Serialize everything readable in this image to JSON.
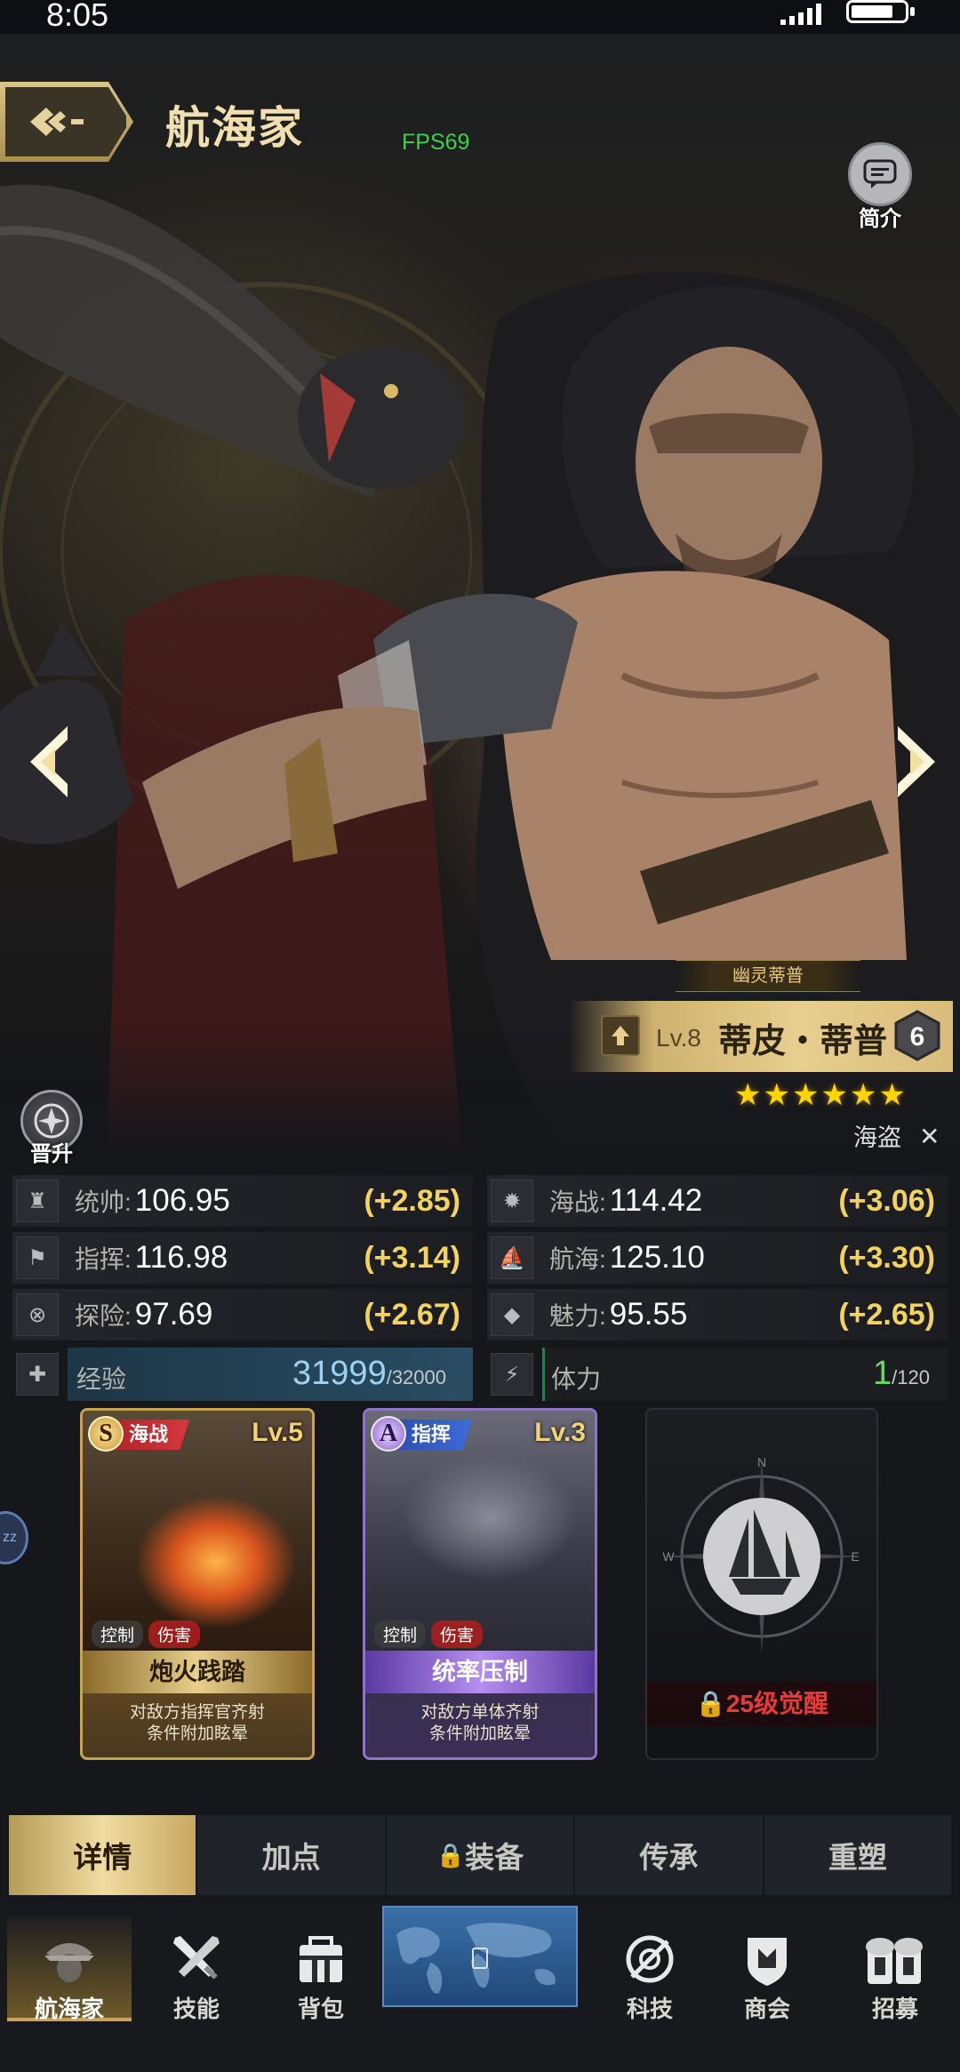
{
  "status_bar": {
    "time": "8:05"
  },
  "header": {
    "title": "航海家",
    "fps": "FPS69",
    "intro_label": "简介"
  },
  "hero": {
    "title_tag": "幽灵蒂普",
    "level": "Lv.8",
    "name": "蒂皮・蒂普",
    "rank": "6",
    "stars": "★★★★★★",
    "star_count": 6,
    "faction": "海盗",
    "promote_label": "晋升"
  },
  "stats": [
    {
      "icon": "general-icon",
      "label": "统帅:",
      "value": "106.95",
      "bonus": "(+2.85)"
    },
    {
      "icon": "naval-battle-icon",
      "label": "海战:",
      "value": "114.42",
      "bonus": "(+3.06)"
    },
    {
      "icon": "command-flag-icon",
      "label": "指挥:",
      "value": "116.98",
      "bonus": "(+3.14)"
    },
    {
      "icon": "sailing-icon",
      "label": "航海:",
      "value": "125.10",
      "bonus": "(+3.30)"
    },
    {
      "icon": "compass-icon",
      "label": "探险:",
      "value": "97.69",
      "bonus": "(+2.67)"
    },
    {
      "icon": "diamond-icon",
      "label": "魅力:",
      "value": "95.55",
      "bonus": "(+2.65)"
    }
  ],
  "experience": {
    "label": "经验",
    "current": "31999",
    "max": "/32000"
  },
  "stamina": {
    "label": "体力",
    "current": "1",
    "max": "/120"
  },
  "skills": [
    {
      "grade": "S",
      "type": "海战",
      "level": "Lv.5",
      "tags": [
        "控制",
        "伤害"
      ],
      "name": "炮火践踏",
      "desc": "对敌方指挥官齐射\n条件附加眩晕"
    },
    {
      "grade": "A",
      "type": "指挥",
      "level": "Lv.3",
      "tags": [
        "控制",
        "伤害"
      ],
      "name": "统率压制",
      "desc": "对敌方单体齐射\n条件附加眩晕"
    }
  ],
  "locked_slot": {
    "text": "25级觉醒",
    "compass_letters": [
      "N",
      "W",
      "E"
    ]
  },
  "side_bubble": "zz",
  "tabs": [
    {
      "label": "详情",
      "active": true
    },
    {
      "label": "加点",
      "active": false
    },
    {
      "label": "装备",
      "active": false,
      "locked": true
    },
    {
      "label": "传承",
      "active": false
    },
    {
      "label": "重塑",
      "active": false
    }
  ],
  "bottom_nav": [
    {
      "icon": "navigator-icon",
      "label": "航海家",
      "active": true
    },
    {
      "icon": "swords-icon",
      "label": "技能"
    },
    {
      "icon": "backpack-icon",
      "label": "背包"
    },
    {
      "icon": "world-map-icon",
      "label": ""
    },
    {
      "icon": "tech-icon",
      "label": "科技"
    },
    {
      "icon": "guild-icon",
      "label": "商会"
    },
    {
      "icon": "recruit-icon",
      "label": "招募"
    }
  ],
  "colors": {
    "gold": "#e8cf8f",
    "bonus_yellow": "#f3d25e",
    "exp_blue": "#9fd2f2",
    "stamina_green": "#6fd26a",
    "locked_red": "#e83a3a"
  }
}
